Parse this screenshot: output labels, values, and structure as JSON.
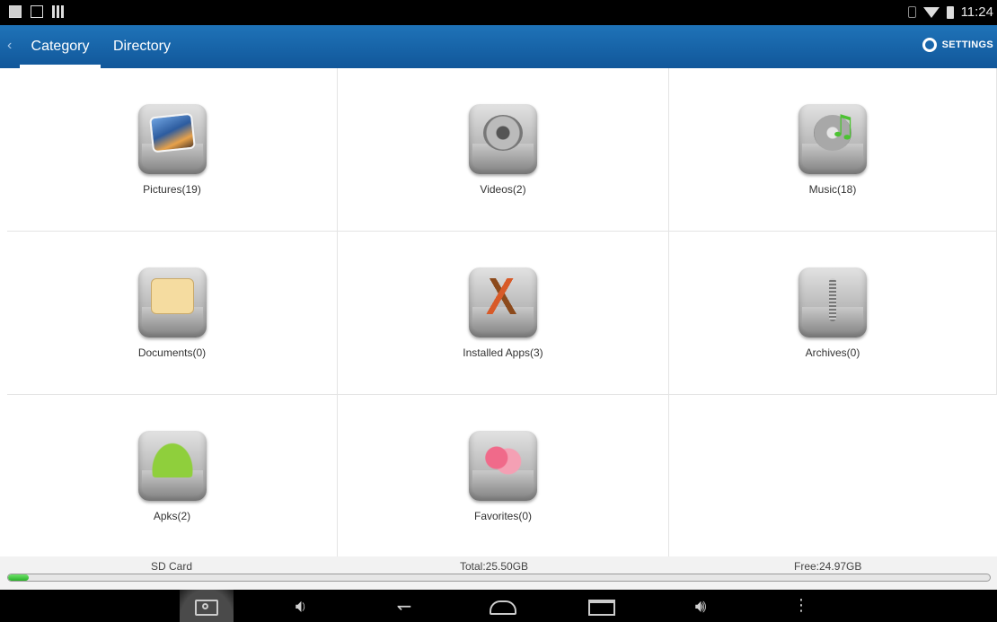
{
  "status_bar": {
    "time": "11:24",
    "icons": [
      "notification-icon",
      "image-icon",
      "barcode-icon",
      "bluetooth-icon",
      "wifi-icon",
      "battery-icon"
    ]
  },
  "action_bar": {
    "tabs": [
      {
        "label": "Category",
        "selected": true
      },
      {
        "label": "Directory",
        "selected": false
      }
    ],
    "settings_label": "SETTINGS",
    "accent_color": "#1565a8"
  },
  "categories": [
    {
      "label": "Pictures(19)",
      "icon": "pictures-icon"
    },
    {
      "label": "Videos(2)",
      "icon": "videos-icon"
    },
    {
      "label": "Music(18)",
      "icon": "music-icon"
    },
    {
      "label": "Documents(0)",
      "icon": "documents-icon"
    },
    {
      "label": "Installed Apps(3)",
      "icon": "installed-apps-icon"
    },
    {
      "label": "Archives(0)",
      "icon": "archives-icon"
    },
    {
      "label": "Apks(2)",
      "icon": "apks-icon"
    },
    {
      "label": "Favorites(0)",
      "icon": "favorites-icon"
    }
  ],
  "storage": {
    "name": "SD Card",
    "total": "Total:25.50GB",
    "free": "Free:24.97GB",
    "used_fraction": 0.021,
    "bar_color": "#3cc23a"
  },
  "nav_bar": {
    "buttons": [
      "screenshot-icon",
      "volume-down-icon",
      "back-icon",
      "home-icon",
      "recent-apps-icon",
      "volume-up-icon",
      "menu-icon"
    ]
  }
}
